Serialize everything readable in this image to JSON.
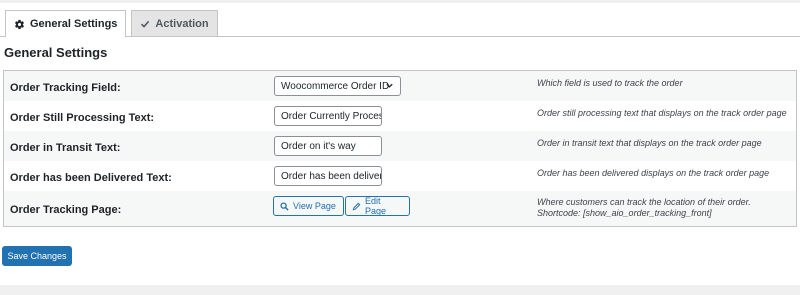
{
  "tabs": [
    {
      "label": "General Settings",
      "icon": "gear-icon",
      "active": true
    },
    {
      "label": "Activation",
      "icon": "checkmark-icon",
      "active": false
    }
  ],
  "section_title": "General Settings",
  "rows": [
    {
      "label": "Order Tracking Field:",
      "control": "select",
      "value": "Woocommerce Order ID",
      "description": "Which field is used to track the order"
    },
    {
      "label": "Order Still Processing Text:",
      "control": "input",
      "value": "Order Currently Processing",
      "description": "Order still processing text that displays on the track order page"
    },
    {
      "label": "Order in Transit Text:",
      "control": "input",
      "value": "Order on it's way",
      "description": "Order in transit text that displays on the track order page"
    },
    {
      "label": "Order has been Delivered Text:",
      "control": "input",
      "value": "Order has been delivered",
      "description": "Order has been delivered displays on the track order page"
    },
    {
      "label": "Order Tracking Page:",
      "control": "buttons",
      "buttons": [
        "View Page",
        "Edit Page"
      ],
      "description_lines": [
        "Where customers can track the location of their order.",
        "Shortcode: [show_aio_order_tracking_front]"
      ]
    }
  ],
  "save_label": "Save Changes",
  "colors": {
    "primary": "#2271b1",
    "row_alt": "#f6f7f7",
    "border": "#c3c4c7"
  }
}
